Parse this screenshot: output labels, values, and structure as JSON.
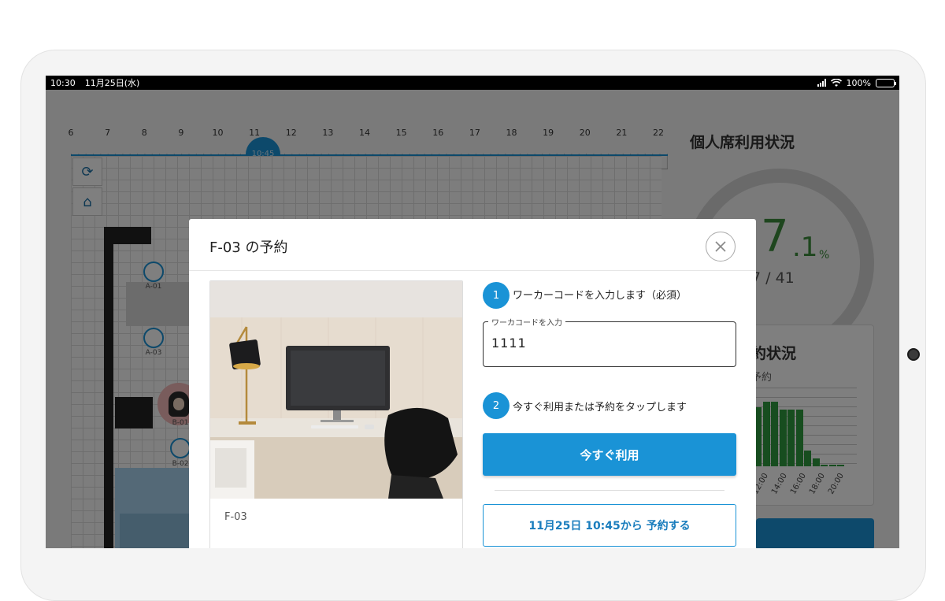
{
  "statusbar": {
    "time": "10:30",
    "date": "11月25日(水)",
    "battery": "100%"
  },
  "timeline": {
    "ticks": [
      "6",
      "7",
      "8",
      "9",
      "10",
      "11",
      "12",
      "13",
      "14",
      "15",
      "16",
      "17",
      "18",
      "19",
      "20",
      "21",
      "22"
    ],
    "current_time": "10:45"
  },
  "floor": {
    "seats": [
      {
        "label": "A-01"
      },
      {
        "label": "A-03"
      },
      {
        "label": "B-01"
      },
      {
        "label": "B-02"
      }
    ]
  },
  "right_panel": {
    "title": "個人席利用状況",
    "gauge_value": "7",
    "gauge_decimal": ".1",
    "gauge_unit": "%",
    "gauge_count": "7 / 41",
    "card_title": "約状況",
    "card_sub": "予約",
    "bar_values": [
      0.75,
      0.82,
      0.82,
      0.72,
      0.72,
      0.72,
      0.2,
      0.1,
      0.02,
      0.02,
      0.02
    ],
    "x_ticks": [
      "12:00",
      "14:00",
      "16:00",
      "18:00",
      "20:00"
    ]
  },
  "modal": {
    "title": "F-03 の予約",
    "seat_name": "F-03",
    "step1_number": "1",
    "step1_text": "ワーカーコードを入力します（必須）",
    "code_label": "ワーカコードを入力",
    "code_value": "1111",
    "step2_number": "2",
    "step2_text": "今すぐ利用または予約をタップします",
    "use_now_label": "今すぐ利用",
    "reserve_label": "11月25日 10:45から 予約する"
  },
  "colors": {
    "accent": "#1a93d6",
    "gauge_green": "#3c8c3c",
    "bar_green": "#2f9b3e"
  }
}
